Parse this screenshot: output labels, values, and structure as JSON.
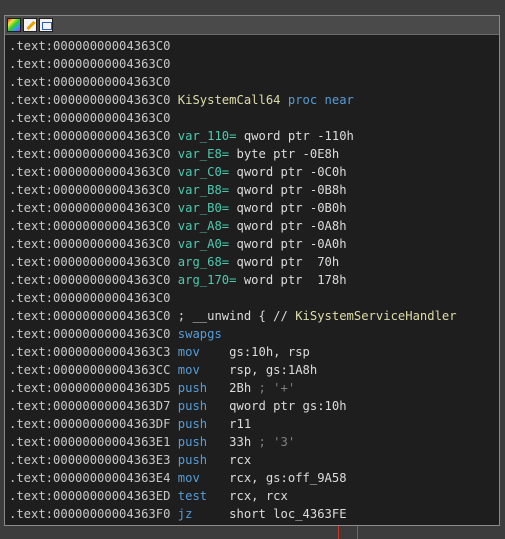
{
  "colors": {
    "background": "#3c3c3c",
    "window_bg": "#1e1e1e",
    "address": "#c8c8c8",
    "mnemonic": "#569cd6",
    "name": "#4ec9b0",
    "comment": "#808080",
    "marker_red": "#c0392b",
    "marker_green": "#2e8b57"
  },
  "toolbar": {
    "icons": [
      "palette-icon",
      "edit-icon",
      "graph-icon"
    ]
  },
  "listing": {
    "lines": [
      {
        "addr": ".text:00000000004363C0",
        "text": ""
      },
      {
        "addr": ".text:00000000004363C0",
        "text": ""
      },
      {
        "addr": ".text:00000000004363C0",
        "text": ""
      },
      {
        "addr": ".text:00000000004363C0",
        "name": "KiSystemCall64",
        "rest": " proc near"
      },
      {
        "addr": ".text:00000000004363C0",
        "text": ""
      },
      {
        "addr": ".text:00000000004363C0",
        "var": "var_110=",
        "rest": " qword ptr -110h"
      },
      {
        "addr": ".text:00000000004363C0",
        "var": "var_E8=",
        "rest": " byte ptr -0E8h"
      },
      {
        "addr": ".text:00000000004363C0",
        "var": "var_C0=",
        "rest": " qword ptr -0C0h"
      },
      {
        "addr": ".text:00000000004363C0",
        "var": "var_B8=",
        "rest": " qword ptr -0B8h"
      },
      {
        "addr": ".text:00000000004363C0",
        "var": "var_B0=",
        "rest": " qword ptr -0B0h"
      },
      {
        "addr": ".text:00000000004363C0",
        "var": "var_A8=",
        "rest": " qword ptr -0A8h"
      },
      {
        "addr": ".text:00000000004363C0",
        "var": "var_A0=",
        "rest": " qword ptr -0A0h"
      },
      {
        "addr": ".text:00000000004363C0",
        "var": "arg_68=",
        "rest": " qword ptr  70h"
      },
      {
        "addr": ".text:00000000004363C0",
        "var": "arg_170=",
        "rest": " word ptr  178h"
      },
      {
        "addr": ".text:00000000004363C0",
        "text": ""
      },
      {
        "addr": ".text:00000000004363C0",
        "comment": "; __unwind { // ",
        "func": "KiSystemServiceHandler"
      },
      {
        "addr": ".text:00000000004363C0",
        "mnem": "swapgs",
        "ops": ""
      },
      {
        "addr": ".text:00000000004363C3",
        "mnem": "mov",
        "ops": "gs:10h, rsp"
      },
      {
        "addr": ".text:00000000004363CC",
        "mnem": "mov",
        "ops": "rsp, gs:1A8h"
      },
      {
        "addr": ".text:00000000004363D5",
        "mnem": "push",
        "ops": "2Bh",
        "cmt": " ; '+'"
      },
      {
        "addr": ".text:00000000004363D7",
        "mnem": "push",
        "ops": "qword ptr gs:10h"
      },
      {
        "addr": ".text:00000000004363DF",
        "mnem": "push",
        "ops": "r11"
      },
      {
        "addr": ".text:00000000004363E1",
        "mnem": "push",
        "ops": "33h",
        "cmt": " ; '3'"
      },
      {
        "addr": ".text:00000000004363E3",
        "mnem": "push",
        "ops": "rcx"
      },
      {
        "addr": ".text:00000000004363E4",
        "mnem": "mov",
        "ops": "rcx, gs:off_9A58"
      },
      {
        "addr": ".text:00000000004363ED",
        "mnem": "test",
        "ops": "rcx, rcx"
      },
      {
        "addr": ".text:00000000004363F0",
        "mnem": "jz",
        "ops": "short loc_4363FE"
      }
    ]
  }
}
